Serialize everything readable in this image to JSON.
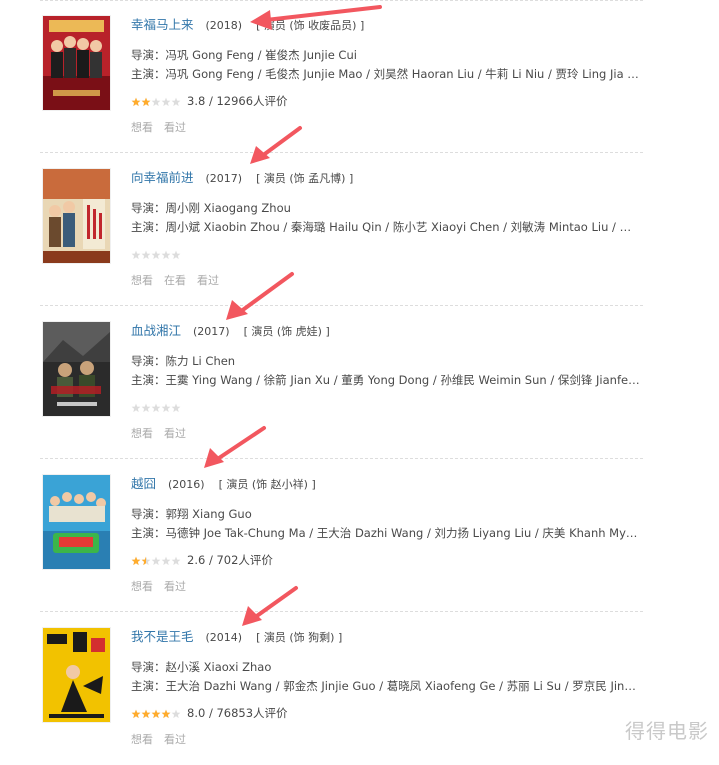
{
  "colors": {
    "link": "#3377aa",
    "text": "#494949",
    "muted": "#aaaaaa",
    "star_on": "#ffac2d",
    "star_off": "#dddddd",
    "arrow": "#f2575f",
    "watermark": "#c9c9c9"
  },
  "works": [
    {
      "title": "幸福马上来",
      "year": "(2018)",
      "role": "[ 演员 (饰 收废品员) ]",
      "director": "导演：冯巩 Gong Feng / 崔俊杰 Junjie Cui",
      "cast": "主演：冯巩 Gong Feng / 毛俊杰 Junjie Mao / 刘昊然 Haoran Liu / 牛莉 Li Niu / 贾玲 Ling Jia / 张...",
      "stars": 2,
      "rating": "3.8 / 12966人评价",
      "actions": [
        "想看",
        "看过"
      ]
    },
    {
      "title": "向幸福前进",
      "year": "(2017)",
      "role": "[ 演员 (饰 孟凡博) ]",
      "director": "导演：周小刚 Xiaogang Zhou",
      "cast": "主演：周小斌 Xiaobin Zhou / 秦海璐 Hailu Qin / 陈小艺 Xiaoyi Chen / 刘敏涛 Mintao Liu / 吴超 Ch...",
      "stars": 0,
      "rating": "",
      "actions": [
        "想看",
        "在看",
        "看过"
      ]
    },
    {
      "title": "血战湘江",
      "year": "(2017)",
      "role": "[ 演员 (饰 虎娃) ]",
      "director": "导演：陈力 Li Chen",
      "cast": "主演：王霙 Ying Wang / 徐箭 Jian Xu / 董勇 Yong Dong / 孙维民 Weimin Sun / 保剑锋 Jianfeng B...",
      "stars": 0,
      "rating": "",
      "actions": [
        "想看",
        "看过"
      ]
    },
    {
      "title": "越囧",
      "year": "(2016)",
      "role": "[ 演员 (饰 赵小祥) ]",
      "director": "导演：郭翔 Xiang Guo",
      "cast": "主演：马德钟 Joe Tak-Chung Ma / 王大治 Dazhi Wang / 刘力扬 Liyang Liu / 庆美 Khanh My / 阮...",
      "stars": 1.5,
      "rating": "2.6 / 702人评价",
      "actions": [
        "想看",
        "看过"
      ]
    },
    {
      "title": "我不是王毛",
      "year": "(2014)",
      "role": "[ 演员 (饰 狗剩) ]",
      "director": "导演：赵小溪 Xiaoxi Zhao",
      "cast": "主演：王大治 Dazhi Wang / 郭金杰 Jinjie Guo / 葛晓凤 Xiaofeng Ge / 苏丽 Li Su / 罗京民 Jingmin ...",
      "stars": 4,
      "rating": "8.0 / 76853人评价",
      "actions": [
        "想看",
        "看过"
      ]
    }
  ],
  "watermark": "得得电影"
}
